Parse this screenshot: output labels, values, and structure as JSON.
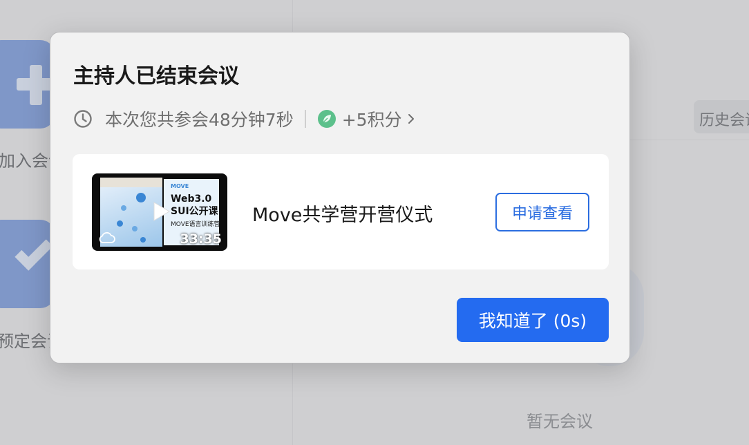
{
  "background": {
    "join_label": "加入会议",
    "book_label": "预定会议",
    "history_label": "历史会议",
    "empty_text": "暂无会议"
  },
  "dialog": {
    "title": "主持人已结束会议",
    "duration_text": "本次您共参会48分钟7秒",
    "points_text": "+5积分",
    "icons": {
      "clock": "clock-icon",
      "points": "leaf-icon",
      "chevron": "chevron-right-icon"
    },
    "recording": {
      "title": "Move共学营开营仪式",
      "duration": "33:35",
      "slide_brand": "MOVE",
      "slide_title_1": "Web3.0",
      "slide_title_2": "SUI公开课",
      "slide_subtitle": "MOVE语言训练营",
      "request_button": "申请查看"
    },
    "ok_button": "我知道了 (0s)"
  },
  "colors": {
    "accent": "#246bf0",
    "points_green": "#5cc08b",
    "background_overlay": "#cfcfd1"
  }
}
